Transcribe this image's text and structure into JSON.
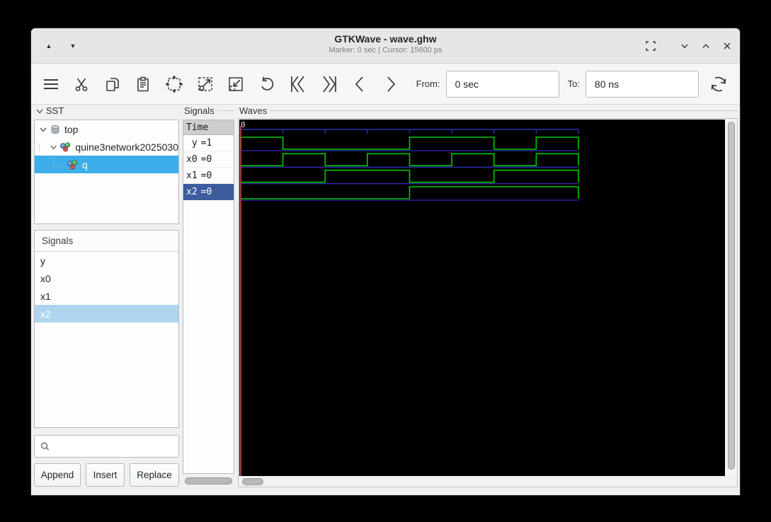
{
  "titlebar": {
    "title": "GTKWave - wave.ghw",
    "subtitle": "Marker: 0 sec  |  Cursor: 15600 ps"
  },
  "toolbar": {
    "from_label": "From:",
    "from_value": "0 sec",
    "to_label": "To:",
    "to_value": "80 ns"
  },
  "sst_panel": {
    "header": "SST",
    "tree": [
      {
        "label": "top"
      },
      {
        "label": "quine3network2025030"
      },
      {
        "label": "q"
      }
    ],
    "list_header": "Signals",
    "list": [
      {
        "label": "y"
      },
      {
        "label": "x0"
      },
      {
        "label": "x1"
      },
      {
        "label": "x2"
      }
    ],
    "buttons": {
      "append": "Append",
      "insert": "Insert",
      "replace": "Replace"
    }
  },
  "signals_panel": {
    "header": "Signals",
    "time_header": "Time",
    "rows": [
      {
        "name": "y",
        "value": "=1"
      },
      {
        "name": "x0",
        "value": "=0"
      },
      {
        "name": "x1",
        "value": "=0"
      },
      {
        "name": "x2",
        "value": "=0"
      }
    ]
  },
  "waves_panel": {
    "header": "Waves",
    "origin_label": "0",
    "chart_data": {
      "type": "digital-waveform",
      "time_unit": "ns",
      "t_start": 0,
      "t_end": 80,
      "tick_interval_ns": 10,
      "marker_time": 0,
      "signals": [
        {
          "name": "y",
          "transitions": [
            [
              0,
              1
            ],
            [
              10,
              0
            ],
            [
              40,
              1
            ],
            [
              60,
              0
            ],
            [
              70,
              1
            ]
          ]
        },
        {
          "name": "x0",
          "transitions": [
            [
              0,
              0
            ],
            [
              10,
              1
            ],
            [
              20,
              0
            ],
            [
              30,
              1
            ],
            [
              40,
              0
            ],
            [
              50,
              1
            ],
            [
              60,
              0
            ],
            [
              70,
              1
            ]
          ]
        },
        {
          "name": "x1",
          "transitions": [
            [
              0,
              0
            ],
            [
              20,
              1
            ],
            [
              40,
              0
            ],
            [
              60,
              1
            ]
          ]
        },
        {
          "name": "x2",
          "transitions": [
            [
              0,
              0
            ],
            [
              40,
              1
            ]
          ]
        }
      ],
      "colors": {
        "background": "#000000",
        "trace": "#00c800",
        "rail": "#2e2eb8",
        "ruler": "#2e2eb8",
        "marker": "#cf5252",
        "origin_text": "#e0e0e0"
      }
    }
  }
}
